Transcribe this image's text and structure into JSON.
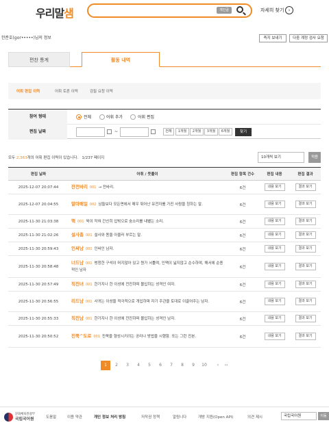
{
  "header": {
    "logo_main": "우리말",
    "logo_accent": "샘",
    "search_button": "개인글",
    "more_label": "자세히 찾기",
    "more_arrow": "›"
  },
  "user": {
    "name": "한준호(gor•••••)님의 정보",
    "btn_subscribe": "즉지 보내기",
    "btn_check": "다중 계정 검사 요청"
  },
  "tabs": {
    "edit_stats": "편찬 통계",
    "activity": "활동 내역"
  },
  "subnav": {
    "item1": "어휘 편집 이력",
    "item2": "어휘 토론 이력",
    "item3": "검필 요청 이력"
  },
  "filter": {
    "type_label": "참여 형태",
    "opt_all": "전체",
    "opt_add": "어휘 추가",
    "opt_edit": "어휘 편집",
    "date_label": "편집 날짜",
    "date_sep": "~",
    "periods": [
      "전체",
      "1개월",
      "2개월",
      "3개월",
      "6개월"
    ],
    "search_btn": "찾기"
  },
  "summary": {
    "prefix": "모두 ",
    "count": "2,363",
    "suffix": "개의 어휘 편집 이력이 있습니다.",
    "page": "1",
    "pages": "/237 페이지"
  },
  "page_size": "10개씩 보기",
  "apply": "적용",
  "table": {
    "headers": [
      "편집 날짜",
      "어휘 / 뜻풀이",
      "편집 항목 건수",
      "편집 내용",
      "편집 결과"
    ],
    "view_btn": "내용 보기",
    "result_btn": "결과 보기",
    "rows": [
      {
        "date": "2025-12-07 20:07:44",
        "word": "잔전바리",
        "num": "001",
        "def": "→ 잔바리.",
        "count": "6건"
      },
      {
        "date": "2025-12-07 20:04:55",
        "word": "말마배일",
        "num": "002",
        "def": "남들보다 모든면에서 매우 뛰어난 유전자를 가진 사람을 칭하는 말.",
        "count": "6건"
      },
      {
        "date": "2025-11-30 21:03:38",
        "word": "핵",
        "num": "001",
        "def": "욱이 작혀 간신히 입밖으로 숨소리를 내뱉는 소리.",
        "count": "6건"
      },
      {
        "date": "2025-11-30 21:02:26",
        "word": "설사총",
        "num": "001",
        "def": "설사와 똥을 아울러 부르는 말.",
        "count": "6건"
      },
      {
        "date": "2025-11-30 20:59:43",
        "word": "인싸남",
        "num": "001",
        "def": "인싸인 남자.",
        "count": "6건"
      },
      {
        "date": "2025-11-30 20:58:48",
        "word": "너드남",
        "num": "001",
        "def": "벙청한 구석이 머지않아 있고 뭔가 서툴며, 인맥이 넓지않고 순수하며, 해서에 순종적인 남자",
        "count": "6건"
      },
      {
        "date": "2025-11-30 20:57:49",
        "word": "직진녀",
        "num": "001",
        "def": "한가지나 한 이성에 전진하며 몰입하는 성격인 여자.",
        "count": "6건"
      },
      {
        "date": "2025-11-30 20:56:55",
        "word": "리드남",
        "num": "001",
        "def": "사귀는 이성을 적극적으로 개입하며 자기 주관을 토대로 이끌어주는 남자.",
        "count": "6건"
      },
      {
        "date": "2025-11-30 20:55:33",
        "word": "직진남",
        "num": "001",
        "def": "한가지나 한 이성에 전진하며 몰입하는 성격인 남자.",
        "count": "6건"
      },
      {
        "date": "2025-11-30 20:50:52",
        "word": "진쭉^도로",
        "num": "001",
        "def": "진쭉을 형성시키려는 공리나 방법을 시행함. 또는 그런 진본.",
        "count": "6건"
      }
    ]
  },
  "pager": {
    "pages": [
      "1",
      "2",
      "3",
      "4",
      "5",
      "6",
      "7",
      "8",
      "9",
      "10"
    ],
    "next": "›",
    "last": "››"
  },
  "footer": {
    "org_line1": "문화체육관광부",
    "org_line2": "국립국어원",
    "links": [
      "도움말",
      "이용 약관",
      "개인 정보 처리 방침",
      "저작권 정책",
      "알림니다",
      "개방 지원(Open API)",
      "의견 제시"
    ],
    "site_select": "국립국어원",
    "go": "이동"
  }
}
